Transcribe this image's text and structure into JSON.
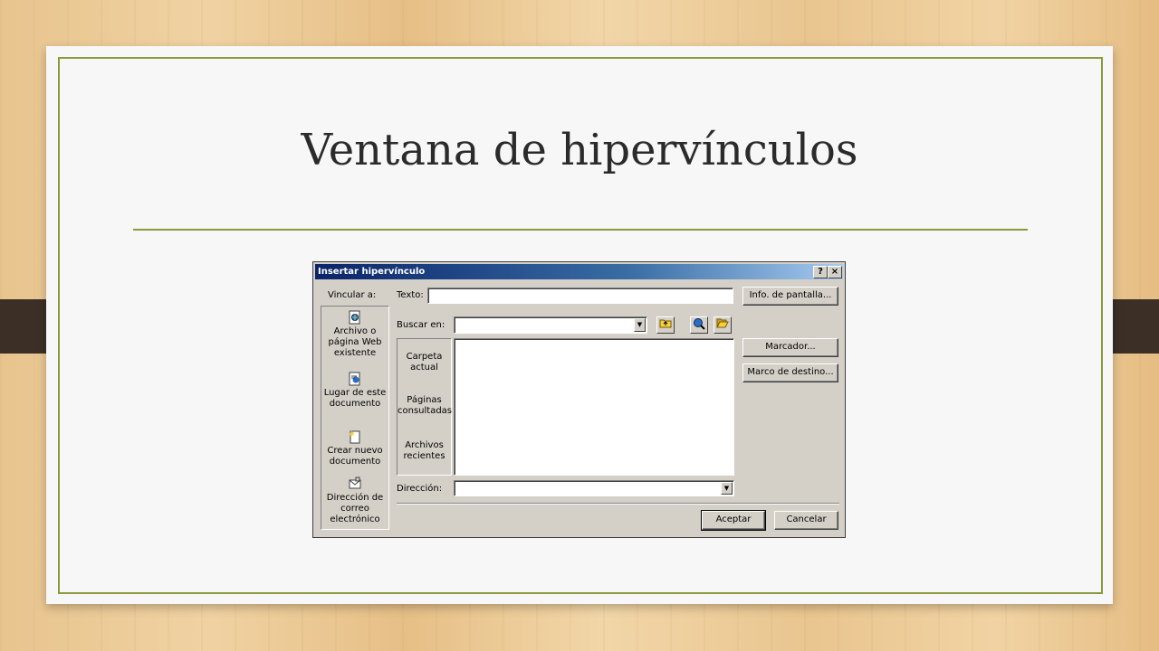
{
  "slide": {
    "title": "Ventana de hipervínculos"
  },
  "dialog": {
    "title": "Insertar hipervínculo",
    "help_label": "?",
    "close_label": "×",
    "link_to_label": "Vincular a:",
    "link_items": [
      {
        "label": "Archivo o página Web existente",
        "icon": "web-file-icon"
      },
      {
        "label": "Lugar de este documento",
        "icon": "document-place-icon"
      },
      {
        "label": "Crear nuevo documento",
        "icon": "new-document-icon"
      },
      {
        "label": "Dirección de correo electrónico",
        "icon": "email-icon"
      }
    ],
    "text_label": "Texto:",
    "text_value": "",
    "screentip_button": "Info. de pantalla...",
    "look_in_label": "Buscar en:",
    "look_in_value": "",
    "places": [
      {
        "label": "Carpeta actual"
      },
      {
        "label": "Páginas consultadas"
      },
      {
        "label": "Archivos recientes"
      }
    ],
    "bookmark_button": "Marcador...",
    "target_frame_button": "Marco de destino...",
    "address_label": "Dirección:",
    "address_value": "",
    "ok_button": "Aceptar",
    "cancel_button": "Cancelar",
    "tool_icons": [
      "up-folder-icon",
      "browse-web-icon",
      "browse-file-icon"
    ]
  },
  "colors": {
    "accent": "#8a9a3a",
    "titlebar": "#0a246a",
    "dialog_face": "#d4d0c8"
  }
}
